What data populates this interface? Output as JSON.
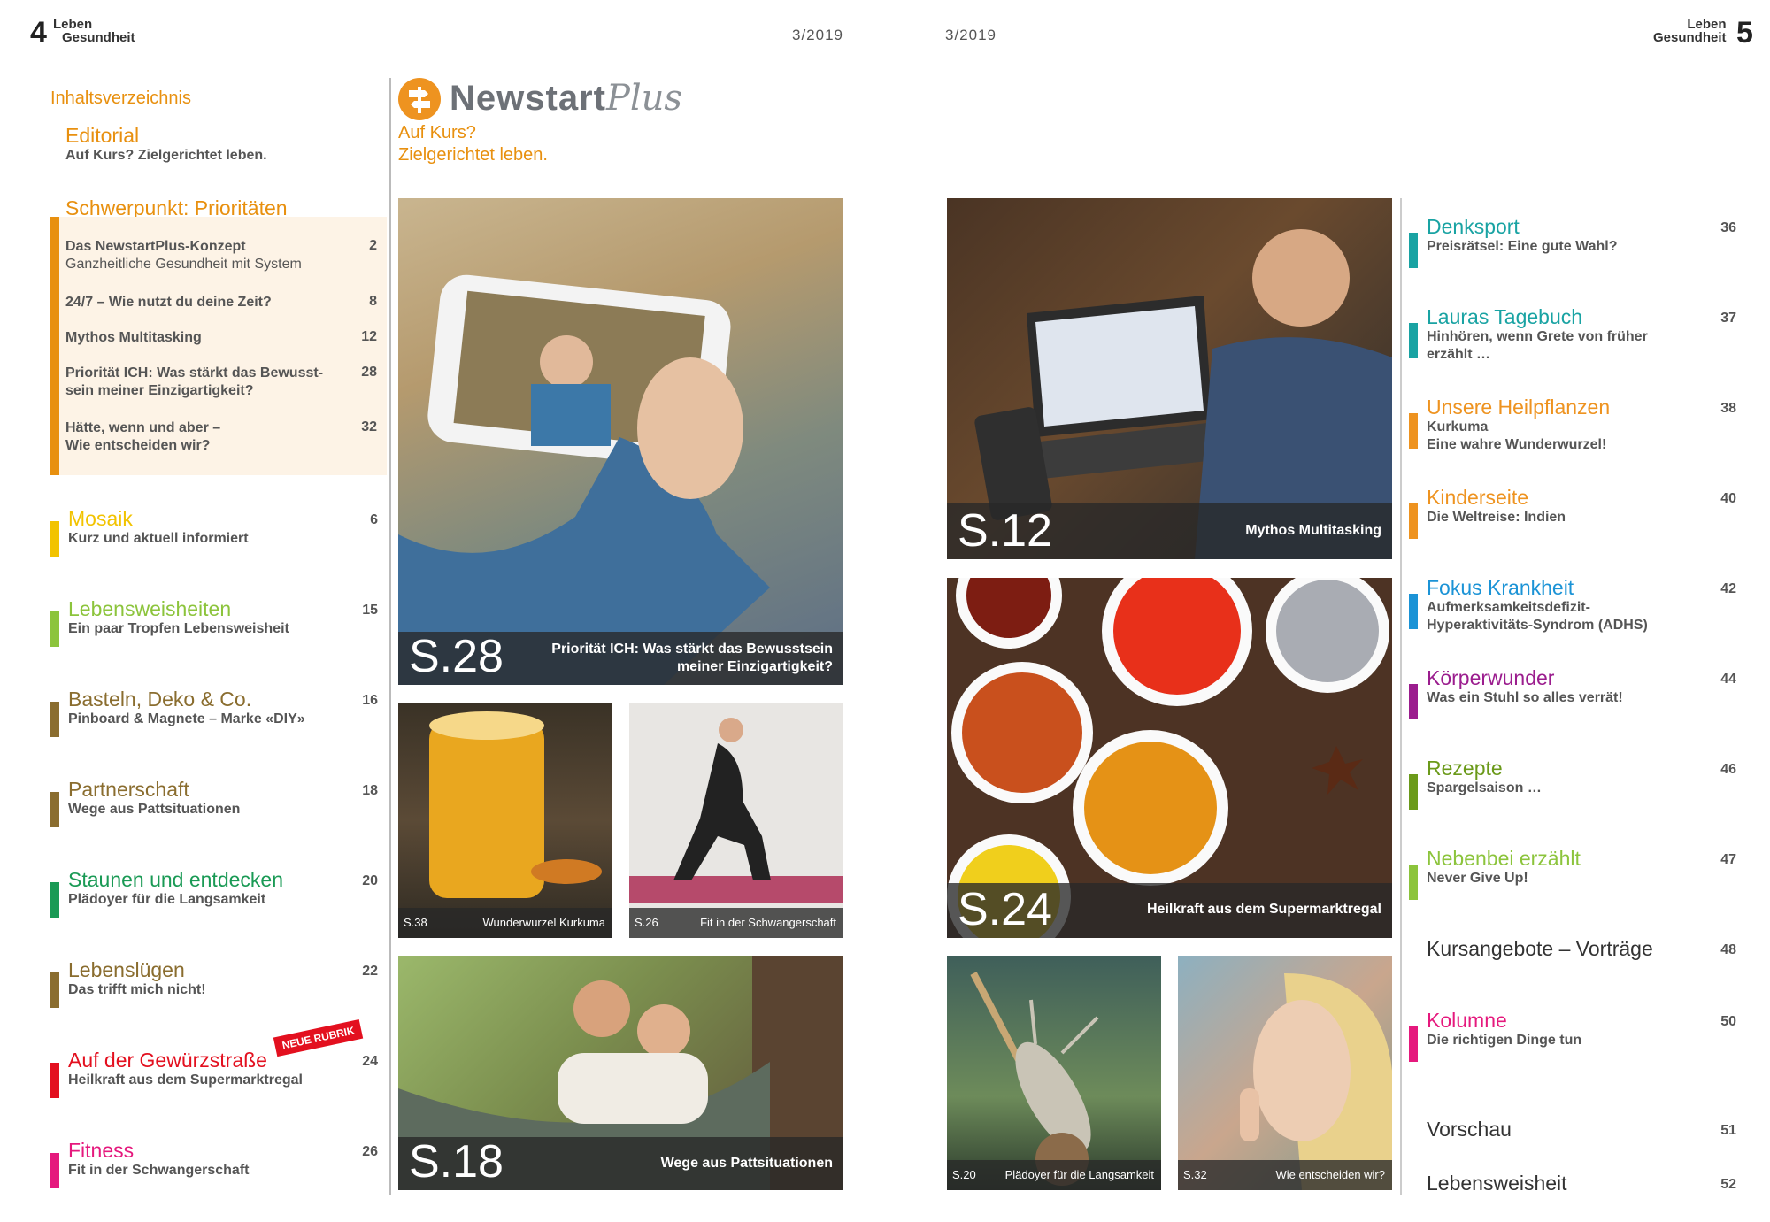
{
  "header": {
    "left_page_number": "4",
    "right_page_number": "5",
    "brand_line1": "Leben",
    "brand_line2": "Gesundheit",
    "issue_left": "3/2019",
    "issue_right": "3/2019"
  },
  "toc": {
    "heading": "Inhaltsverzeichnis",
    "editorial": {
      "title": "Editorial",
      "subtitle": "Auf Kurs? Zielgerichtet leben."
    },
    "focus": {
      "title": "Schwerpunkt: Prioritäten",
      "items": [
        {
          "line1": "Das NewstartPlus-Konzept",
          "line2": "Ganzheitliche Gesundheit mit System",
          "page": "2"
        },
        {
          "line1": "24/7 – Wie nutzt du deine Zeit?",
          "line2": "",
          "page": "8"
        },
        {
          "line1": "Mythos Multitasking",
          "line2": "",
          "page": "12"
        },
        {
          "line1": "Priorität ICH: Was stärkt das Bewusst-",
          "line2": "sein meiner Einzigartigkeit?",
          "page": "28"
        },
        {
          "line1": "Hätte, wenn und aber –",
          "line2": "Wie entscheiden wir?",
          "page": "32"
        }
      ]
    },
    "sections": [
      {
        "title": "Mosaik",
        "subtitle": "Kurz und aktuell informiert",
        "page": "6"
      },
      {
        "title": "Lebensweisheiten",
        "subtitle": "Ein paar Tropfen Lebensweisheit",
        "page": "15"
      },
      {
        "title": "Basteln, Deko & Co.",
        "subtitle": "Pinboard & Magnete – Marke «DIY»",
        "page": "16"
      },
      {
        "title": "Partnerschaft",
        "subtitle": "Wege aus Pattsituationen",
        "page": "18"
      },
      {
        "title": "Staunen und entdecken",
        "subtitle": "Plädoyer für die Langsamkeit",
        "page": "20"
      },
      {
        "title": "Lebenslügen",
        "subtitle": "Das trifft mich nicht!",
        "page": "22"
      },
      {
        "title": "Auf der Gewürzstraße",
        "subtitle": "Heilkraft aus dem Supermarktregal",
        "page": "24"
      },
      {
        "title": "Fitness",
        "subtitle": "Fit in der Schwangerschaft",
        "page": "26"
      }
    ],
    "new_badge": "NEUE RUBRIK"
  },
  "logo": {
    "name_main": "NewstartPlus",
    "main": "Newstart",
    "plus": "Plus",
    "tagline_line1": "Auf Kurs?",
    "tagline_line2": "Zielgerichtet leben."
  },
  "photos": {
    "p28": {
      "num": "S.28",
      "line1": "Priorität ICH: Was stärkt das Bewusstsein",
      "line2": "meiner Einzigartigkeit?"
    },
    "p38": {
      "num": "S.38",
      "text": "Wunderwurzel Kurkuma"
    },
    "p26": {
      "num": "S.26",
      "text": "Fit in der Schwangerschaft"
    },
    "p18": {
      "num": "S.18",
      "text": "Wege aus Pattsituationen"
    },
    "p12": {
      "num": "S.12",
      "text": "Mythos Multitasking"
    },
    "p24": {
      "num": "S.24",
      "text": "Heilkraft aus dem Supermarktregal"
    },
    "p20": {
      "num": "S.20",
      "text": "Plädoyer für die Langsamkeit"
    },
    "p32": {
      "num": "S.32",
      "text": "Wie entscheiden wir?"
    }
  },
  "right_toc": [
    {
      "title": "Denksport",
      "line1": "Preisrätsel: Eine gute Wahl?",
      "line2": "",
      "page": "36"
    },
    {
      "title": "Lauras Tagebuch",
      "line1": "Hinhören, wenn Grete von früher",
      "line2": "erzählt …",
      "page": "37"
    },
    {
      "title": "Unsere Heilpflanzen",
      "line1": "Kurkuma",
      "line2": "Eine wahre Wunderwurzel!",
      "page": "38"
    },
    {
      "title": "Kinderseite",
      "line1": "Die Weltreise: Indien",
      "line2": "",
      "page": "40"
    },
    {
      "title": "Fokus Krankheit",
      "line1": "Aufmerksamkeitsdefizit-",
      "line2": "Hyperaktivitäts-Syndrom (ADHS)",
      "page": "42"
    },
    {
      "title": "Körperwunder",
      "line1": "Was ein Stuhl so alles verrät!",
      "line2": "",
      "page": "44"
    },
    {
      "title": "Rezepte",
      "line1": "Spargelsaison …",
      "line2": "",
      "page": "46"
    },
    {
      "title": "Nebenbei erzählt",
      "line1": "Never Give Up!",
      "line2": "",
      "page": "47"
    },
    {
      "title": "Kolumne",
      "line1": "Die richtigen Dinge tun",
      "line2": "",
      "page": "50"
    }
  ],
  "right_plain": [
    {
      "title": "Kursangebote – Vorträge",
      "page": "48"
    },
    {
      "title": "Vorschau",
      "page": "51"
    },
    {
      "title": "Lebensweisheit",
      "page": "52"
    }
  ],
  "colors": {
    "orange": "#e8900f",
    "yellow": "#f2c300",
    "lime": "#8cc43c",
    "brown": "#8a6d2f",
    "green": "#1a9a55",
    "red": "#e3101f",
    "pink": "#e5197d",
    "teal": "#19a3a3",
    "blue": "#1b93d6",
    "purple": "#9b1d8e",
    "olive": "#6b9a1a"
  }
}
